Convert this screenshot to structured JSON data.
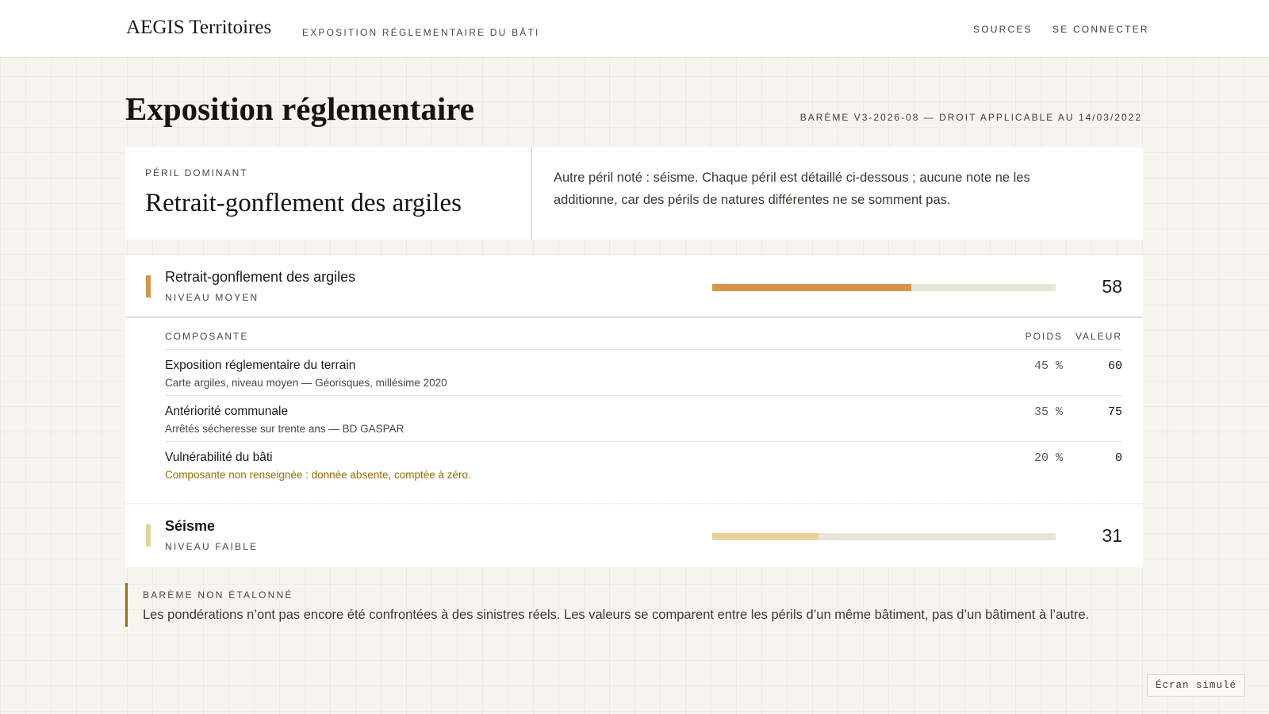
{
  "header": {
    "brand": "AEGIS Territoires",
    "tagline": "EXPOSITION RÉGLEMENTAIRE DU BÂTI",
    "nav": {
      "sources": "SOURCES",
      "login": "SE CONNECTER"
    }
  },
  "page": {
    "title": "Exposition réglementaire",
    "meta": "BARÈME V3-2026-08 — DROIT APPLICABLE AU 14/03/2022"
  },
  "summary": {
    "kicker": "PÉRIL DOMINANT",
    "peril": "Retrait-gonflement des argiles",
    "note": "Autre péril noté : séisme. Chaque péril est détaillé ci-dessous ; aucune note ne les additionne, car des périls de natures différentes ne se somment pas."
  },
  "perils": [
    {
      "name": "Retrait-gonflement des argiles",
      "level": "NIVEAU MOYEN",
      "score": "58",
      "score_fraction": 0.58,
      "color": "#d4964a",
      "components_header": {
        "name": "COMPOSANTE",
        "weight": "POIDS",
        "value": "VALEUR"
      },
      "components": [
        {
          "name": "Exposition réglementaire du terrain",
          "source": "Carte argiles, niveau moyen — Géorisques, millésime 2020",
          "weight": "45 %",
          "value": "60"
        },
        {
          "name": "Antériorité communale",
          "source": "Arrêtés sécheresse sur trente ans — BD GASPAR",
          "weight": "35 %",
          "value": "75"
        },
        {
          "name": "Vulnérabilité du bâti",
          "source": "Composante non renseignée : donnée absente, comptée à zéro.",
          "weight": "20 %",
          "value": "0"
        }
      ]
    },
    {
      "name": "Séisme",
      "level": "NIVEAU FAIBLE",
      "score": "31",
      "score_fraction": 0.31,
      "color": "#e6d39a"
    }
  ],
  "callout": {
    "title": "BARÈME NON ÉTALONNÉ",
    "text": "Les pondérations n’ont pas encore été confrontées à des sinistres réels. Les valeurs se comparent entre les périls d’un même bâtiment, pas d’un bâtiment à l’autre."
  },
  "badge": "Écran simulé"
}
